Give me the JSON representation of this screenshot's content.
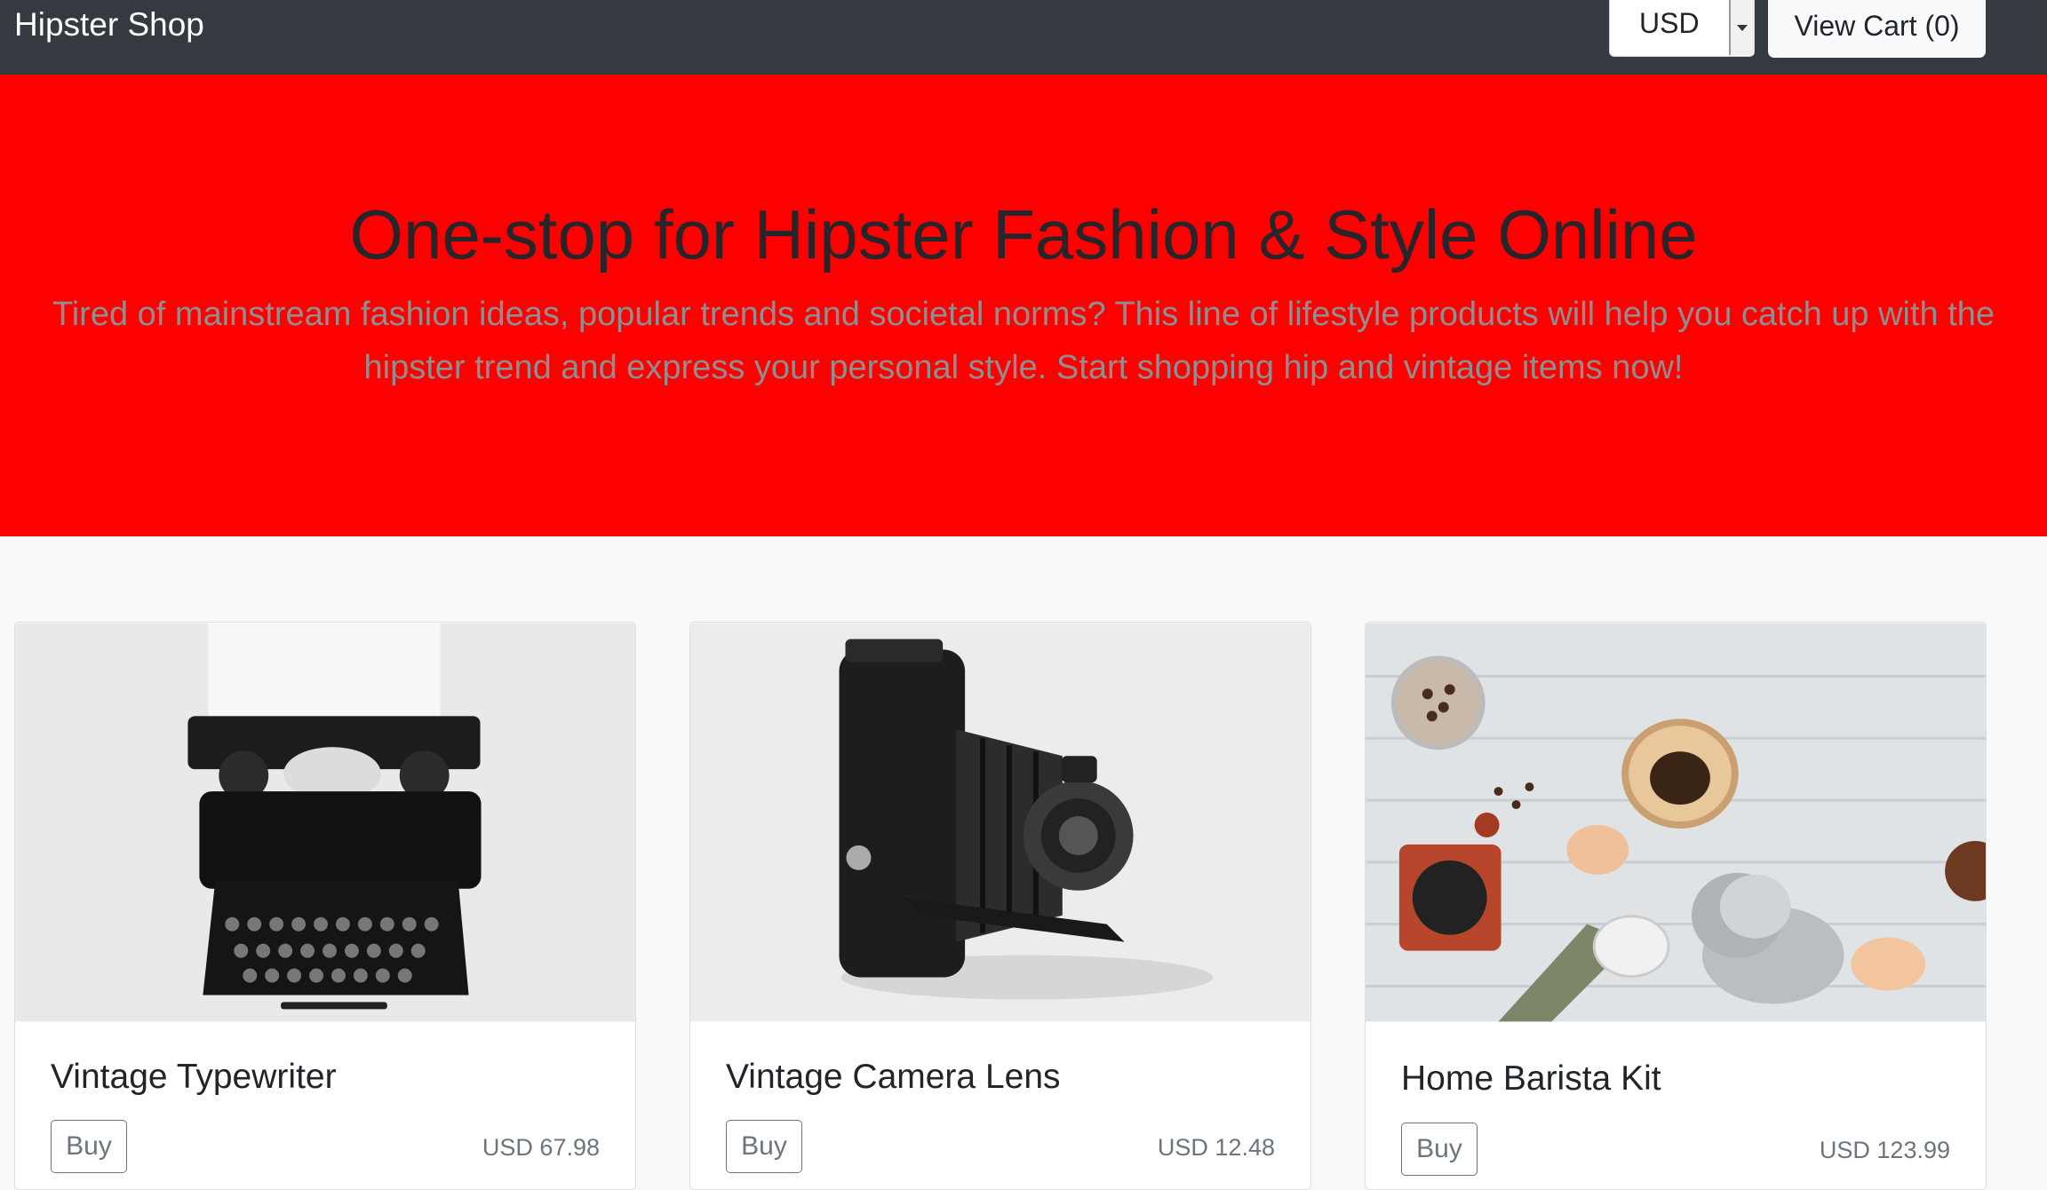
{
  "navbar": {
    "brand": "Hipster Shop",
    "currency": {
      "selected": "USD"
    },
    "cart_button": "View Cart (0)"
  },
  "hero": {
    "title": "One-stop for Hipster Fashion & Style Online",
    "lead_line1": "Tired of mainstream fashion ideas, popular trends and societal norms? This line of lifestyle products will help you catch up with the",
    "lead_line2": "hipster trend and express your personal style. Start shopping hip and vintage items now!",
    "background": "#ff0000"
  },
  "products": [
    {
      "name": "Vintage Typewriter",
      "buy_label": "Buy",
      "price": "USD 67.98",
      "image": "typewriter-image"
    },
    {
      "name": "Vintage Camera Lens",
      "buy_label": "Buy",
      "price": "USD 12.48",
      "image": "camera-image"
    },
    {
      "name": "Home Barista Kit",
      "buy_label": "Buy",
      "price": "USD 123.99",
      "image": "barista-kit-image"
    }
  ]
}
